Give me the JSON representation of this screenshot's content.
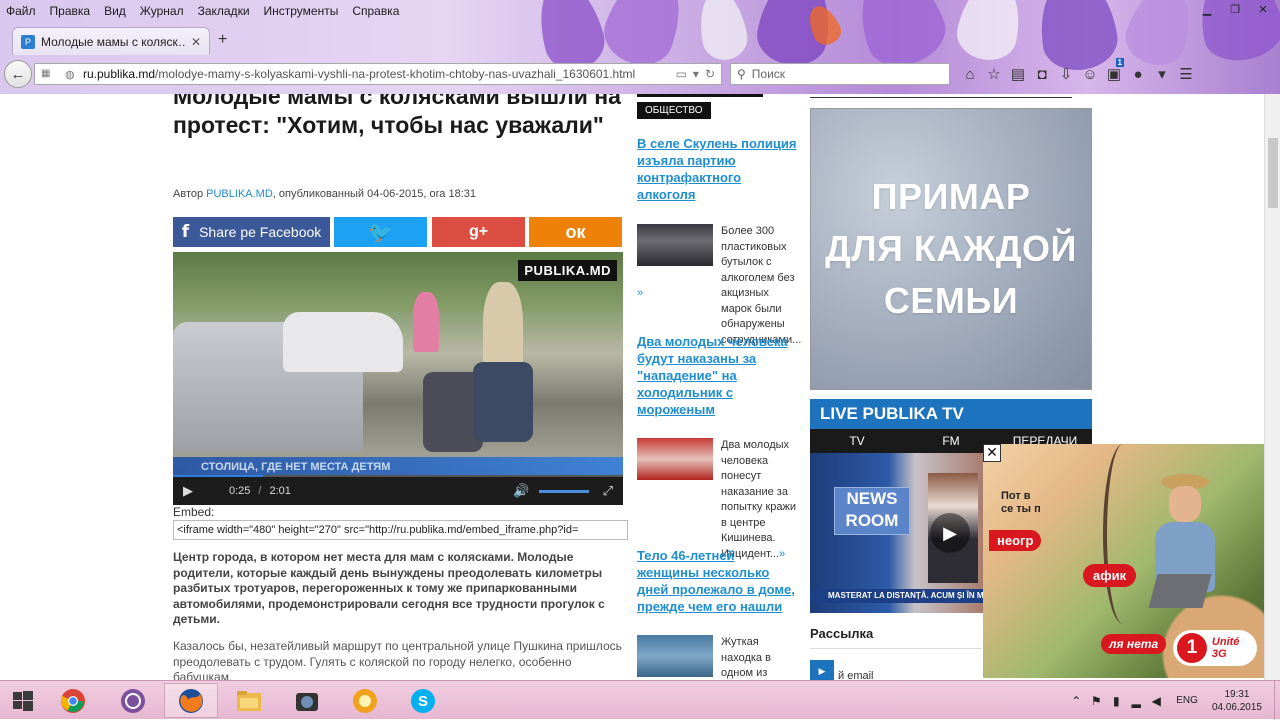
{
  "browser": {
    "menu": [
      "Файл",
      "Правка",
      "Вид",
      "Журнал",
      "Закладки",
      "Инструменты",
      "Справка"
    ],
    "tab_title": "Молодые мамы с коляск…",
    "url_domain": "ru.publika.md",
    "url_path": "/molodye-mamy-s-kolyaskami-vyshli-na-protest-khotim-chtoby-nas-uvazhali_1630601.html",
    "search_placeholder": "Поиск",
    "badge_count": "1"
  },
  "article": {
    "title": "Молодые мамы с колясками вышли на протест: \"Хотим, чтобы нас уважали\"",
    "byline_prefix": "Автор",
    "byline_author": "PUBLIKA.MD",
    "byline_suffix": ", опубликованный 04-06-2015, ora 18:31",
    "share_facebook": "Share pe Facebook",
    "share_gplus": "g+",
    "video": {
      "logo": "PUBLIKA.MD",
      "ticker": "СТОЛИЦА, ГДЕ НЕТ МЕСТА ДЕТЯМ",
      "time_current": "0:25",
      "time_sep": "/",
      "time_total": "2:01",
      "progress": 0.2
    },
    "embed_label": "Embed:",
    "embed_code": "<iframe width=\"480\" height=\"270\" src=\"http://ru.publika.md/embed_iframe.php?id=",
    "lead": "Центр города, в котором нет места для мам с колясками. Молодые родители, которые каждый день вынуждены преодолевать километры разбитых тротуаров, перегороженных к тому же припаркованными автомобилями, продемонстрировали сегодня все трудности прогулок с детьми.",
    "body": "Казалось бы, незатейливый маршрут по центральной улице Пушкина пришлось преодолевать с трудом. Гулять с коляской по городу нелегко, особенно бабушкам."
  },
  "sidebar_news": {
    "section": "ОБЩЕСТВО",
    "items": [
      {
        "title": "В селе Скулень полиция изъяла партию контрафактного алкоголя",
        "text": "Более 300 пластиковых бутылок с алкоголем без акцизных марок были обнаружены сотрудниками...",
        "more": "»"
      },
      {
        "title": "Два молодых человека будут наказаны за \"нападение\" на холодильник с мороженым",
        "text": "Два молодых человека понесут наказание за попытку кражи в центре Кишинева. Инцидент...",
        "more": "»"
      },
      {
        "title": "Тело 46-летней женщины несколько дней пролежало в доме, прежде чем его нашли",
        "text": "Жуткая находка в одном из",
        "more": ""
      }
    ]
  },
  "right": {
    "ad_text": [
      "ПРИМАР",
      "ДЛЯ КАЖДОЙ",
      "СЕМЬИ"
    ],
    "live_tv_title": "LIVE PUBLIKA TV",
    "tv_tabs": [
      "TV",
      "FM",
      "ПЕРЕДАЧИ"
    ],
    "newsroom": "NEWS ROOM",
    "tv_caption": "MASTERAT LA DISTANȚĂ. ACUM ȘI ÎN M",
    "newsletter_title": "Рассылка",
    "newsletter_email_label": "й email"
  },
  "float_ad": {
    "text1": "Пот в се ты п",
    "red1": "неогр",
    "red2": "афик",
    "red3": "ля нета",
    "brand": "Unité 3G",
    "brand_one": "1"
  },
  "taskbar": {
    "lang": "ENG",
    "time": "19:31",
    "date": "04.06.2015"
  },
  "colors": {
    "link": "#1f8ed1",
    "facebook": "#3b5998",
    "twitter": "#1da1f2",
    "gplus": "#dc4e41",
    "ok": "#ee8208",
    "live_tv": "#1e73be",
    "unite_red": "#d9171e"
  }
}
